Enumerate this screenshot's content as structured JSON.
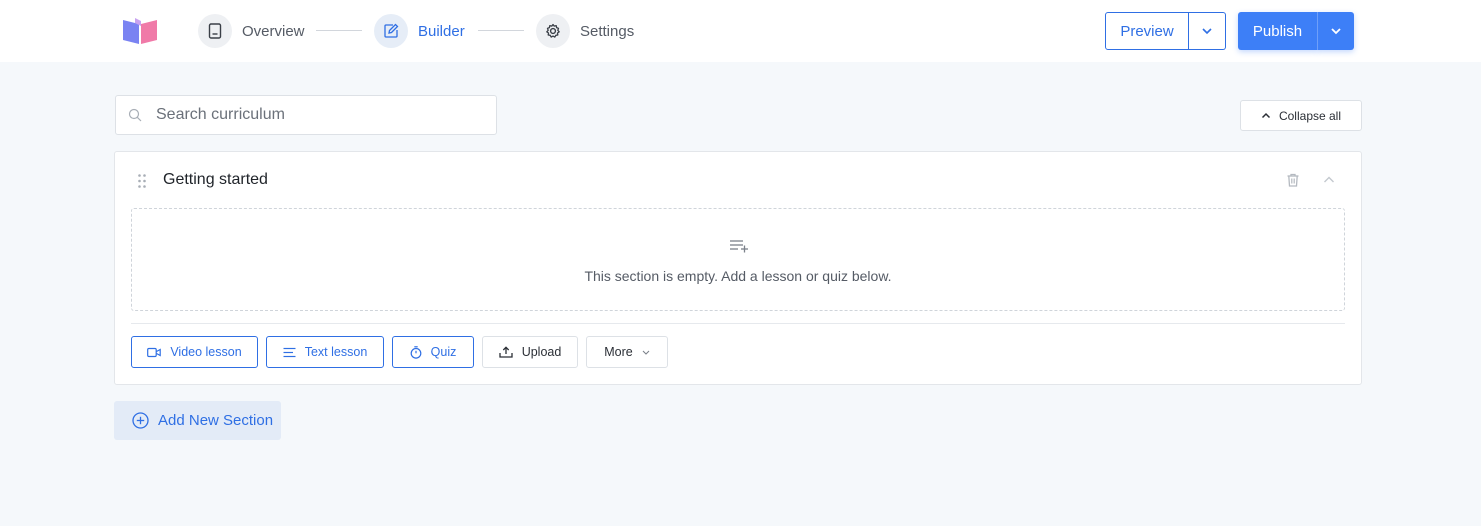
{
  "app": {
    "accent": "#3d7ff7",
    "link_color": "#2f6fe4"
  },
  "header": {
    "logo_icon": "open-book-icon",
    "steps": [
      {
        "label": "Overview",
        "icon": "book-icon",
        "active": false
      },
      {
        "label": "Builder",
        "icon": "edit-icon",
        "active": true
      },
      {
        "label": "Settings",
        "icon": "gear-icon",
        "active": false
      }
    ],
    "preview_label": "Preview",
    "publish_label": "Publish"
  },
  "toolbar": {
    "search_placeholder": "Search curriculum",
    "search_value": "",
    "collapse_label": "Collapse all"
  },
  "section": {
    "title": "Getting started",
    "empty_message": "This section is empty. Add a lesson or quiz below.",
    "actions": {
      "video": "Video lesson",
      "text": "Text lesson",
      "quiz": "Quiz",
      "upload": "Upload",
      "more": "More"
    }
  },
  "add_section_label": "Add New Section"
}
